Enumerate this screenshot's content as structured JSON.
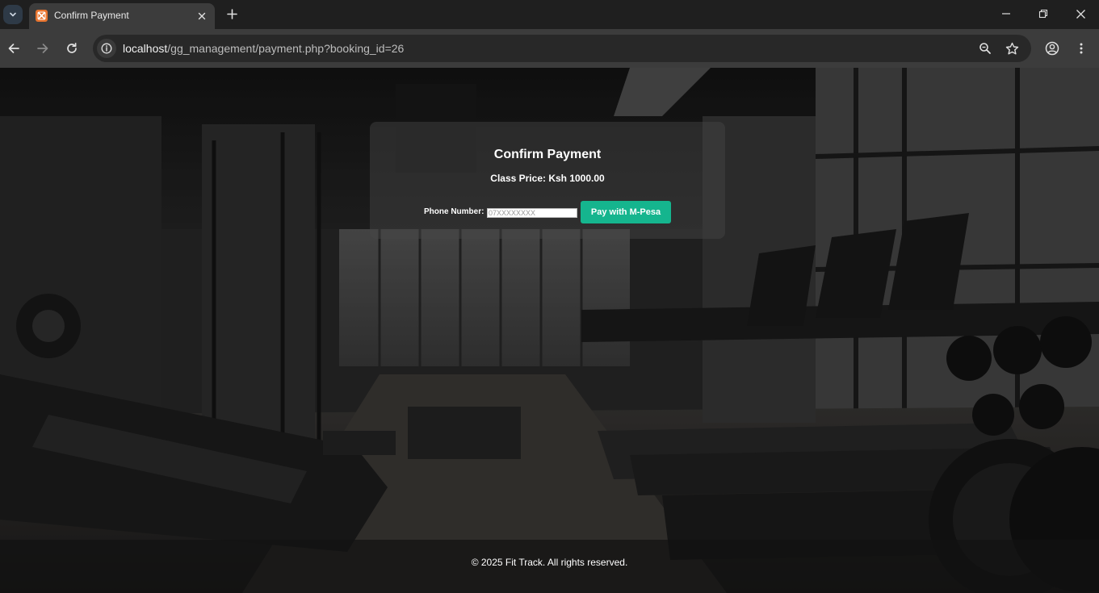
{
  "browser": {
    "tab_title": "Confirm Payment",
    "url_host": "localhost",
    "url_path": "/gg_management/payment.php?booking_id=26"
  },
  "icons": {
    "tab_menu": "chevron-down-icon",
    "favicon": "xampp-icon",
    "tab_close": "close-icon",
    "new_tab": "plus-icon",
    "minimize": "minimize-icon",
    "restore": "restore-icon",
    "close_window": "close-icon",
    "back": "arrow-left-icon",
    "forward": "arrow-right-icon",
    "reload": "reload-icon",
    "site_info": "info-icon",
    "zoom": "zoom-icon",
    "bookmark": "star-icon",
    "profile": "profile-icon",
    "menu": "kebab-menu-icon"
  },
  "payment": {
    "title": "Confirm Payment",
    "price_text": "Class Price: Ksh 1000.00",
    "phone_label": "Phone Number:",
    "phone_placeholder": "07XXXXXXXX",
    "pay_button": "Pay with M-Pesa"
  },
  "footer": {
    "text": "© 2025 Fit Track. All rights reserved."
  },
  "colors": {
    "accent": "#15b58e",
    "chrome_bg": "#1f1f1f",
    "toolbar_bg": "#3c3c3c",
    "favicon": "#e8742e"
  }
}
